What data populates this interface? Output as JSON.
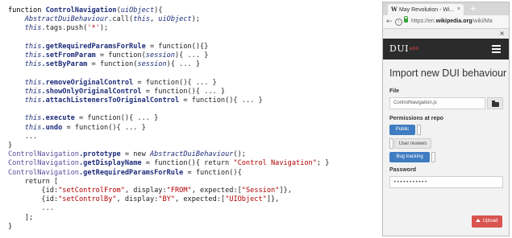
{
  "code": {
    "l1": "function",
    "l1_name": "ControlNavigation",
    "l1_param": "uiObject",
    "l2_class": "AbstractDuiBehaviour",
    "l2_call": ".call(",
    "l2_this": "this",
    "l2_param": "uiObject",
    "l2_end": ");",
    "l3_this": "this",
    "l3_rest": ".tags.push(",
    "l3_str": "'*'",
    "l3_end": ");",
    "l5_this": "this",
    "l5_name": ".getRequiredParamsForRule",
    "l5_rest": " = function(){}",
    "l6_this": "this",
    "l6_name": ".setFromParam",
    "l6_rest": " = function(",
    "l6_param": "session",
    "l6_end": "){ ... }",
    "l7_this": "this",
    "l7_name": ".setByParam",
    "l7_rest": " = function(",
    "l7_param": "session",
    "l7_end": "){ ... }",
    "l9_this": "this",
    "l9_name": ".removeOriginalControl",
    "l9_rest": " = function(){ ... }",
    "l10_this": "this",
    "l10_name": ".showOnlyOriginalControl",
    "l10_rest": " = function(){ ... }",
    "l11_this": "this",
    "l11_name": ".attachListenersToOriginalControl",
    "l11_rest": " = function(){ ... }",
    "l13_this": "this",
    "l13_name": ".execute",
    "l13_rest": " = function(){ ... }",
    "l14_this": "this",
    "l14_name": ".undo",
    "l14_rest": " = function(){ ... }",
    "l15": "...",
    "l16": "}",
    "l17_obj": "ControlNavigation",
    "l17_prop": ".prototype",
    "l17_mid": " = new ",
    "l17_class": "AbstractDuiBehaviour",
    "l17_end": "();",
    "l18_obj": "ControlNavigation",
    "l18_prop": ".getDisplayName",
    "l18_mid": " = function(){ return ",
    "l18_str": "\"Control Navigation\"",
    "l18_end": "; }",
    "l19_obj": "ControlNavigation",
    "l19_prop": ".getRequiredParamsForRule",
    "l19_rest": " = function(){",
    "l20": "return [",
    "l21_a": "{id:",
    "l21_id": "\"setControlFrom\"",
    "l21_b": ", display:",
    "l21_disp": "\"FROM\"",
    "l21_c": ", expected:[",
    "l21_exp": "\"Session\"",
    "l21_d": "]},",
    "l22_a": "{id:",
    "l22_id": "\"setControlBy\"",
    "l22_b": ", display:",
    "l22_disp": "\"BY\"",
    "l22_c": ", expected:[",
    "l22_exp": "\"UIObject\"",
    "l22_d": "]},",
    "l23": "...",
    "l24": "];",
    "l25": "}"
  },
  "browser": {
    "tab_favicon": "W",
    "tab_title": "May Revolution - Wi...",
    "tab_close": "×",
    "new_tab": "+",
    "url_prefix": "https://en.",
    "url_domain": "wikipedia.org",
    "url_suffix": "/wiki/Ma",
    "close_panel": "×"
  },
  "app": {
    "logo": "DUI",
    "logo_sub": "edit",
    "heading": "Import new DUI behaviour",
    "file_label": "File",
    "file_value": "ControlNavigation.js",
    "permissions_label": "Permissions at repo",
    "toggles": [
      {
        "label": "Public",
        "state": "on"
      },
      {
        "label": "User reviews",
        "state": "off"
      },
      {
        "label": "Bug tracking",
        "state": "on"
      }
    ],
    "password_label": "Password",
    "password_value": "•••••••••••",
    "upload_label": "Upload"
  },
  "colors": {
    "accent_blue": "#3f7cc1",
    "upload_red": "#d9534f",
    "appbar": "#2b2b2b"
  }
}
